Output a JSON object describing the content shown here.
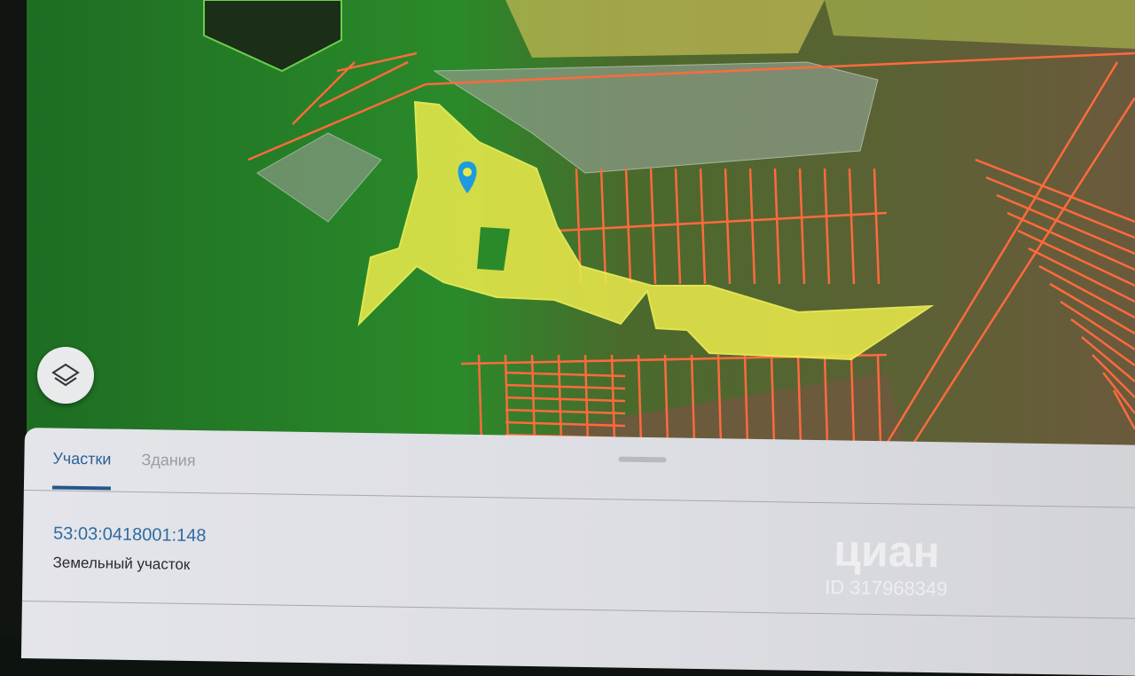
{
  "map": {
    "layers_button_icon": "layers-icon",
    "marker_icon": "location-pin-icon",
    "colors": {
      "selected_parcel": "#e8e84a",
      "parcel_border": "#ff6a3d",
      "forest": "#1f8a2a",
      "pin": "#1e9be0"
    }
  },
  "sheet": {
    "tabs": [
      {
        "label": "Участки",
        "active": true
      },
      {
        "label": "Здания",
        "active": false
      }
    ],
    "parcel": {
      "cadastral_number": "53:03:0418001:148",
      "type": "Земельный участок"
    },
    "watermark": {
      "brand": "циан",
      "id": "ID 317968349"
    }
  }
}
